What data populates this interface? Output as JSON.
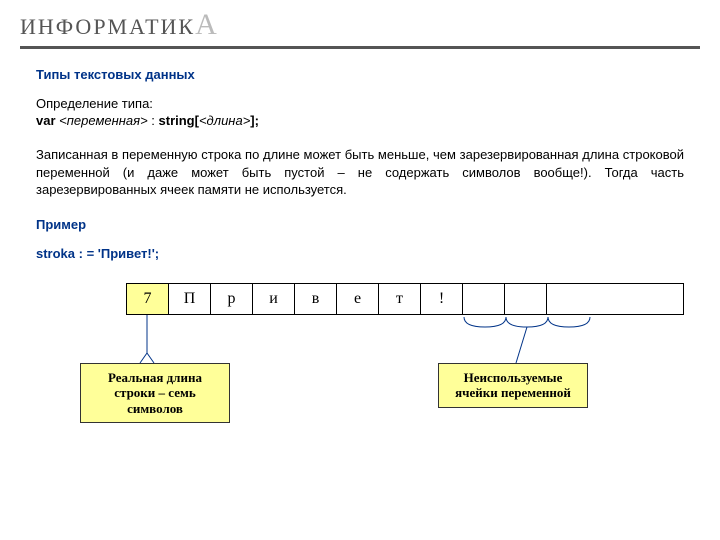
{
  "header": {
    "title_main": "ИНФОРМАТИК",
    "title_last": "А"
  },
  "section_title": "Типы текстовых данных",
  "definition": {
    "label": "Определение типа:",
    "kw_var": "var",
    "variable": "<переменная>",
    "sep": " : ",
    "kw_string": "string[",
    "length": "<длина>",
    "end": "];"
  },
  "paragraph": "Записанная в переменную строка по длине может быть меньше, чем зарезервированная длина строковой переменной (и даже может быть пустой – не содержать символов вообще!). Тогда часть зарезервированных ячеек памяти не используется.",
  "example_label": "Пример",
  "example_code": "stroka : = 'Привет!';",
  "cells": [
    "7",
    "П",
    "р",
    "и",
    "в",
    "е",
    "т",
    "!",
    "",
    "",
    ""
  ],
  "callouts": {
    "left": "Реальная длина строки – семь символов",
    "right": "Неиспользуемые ячейки переменной"
  }
}
